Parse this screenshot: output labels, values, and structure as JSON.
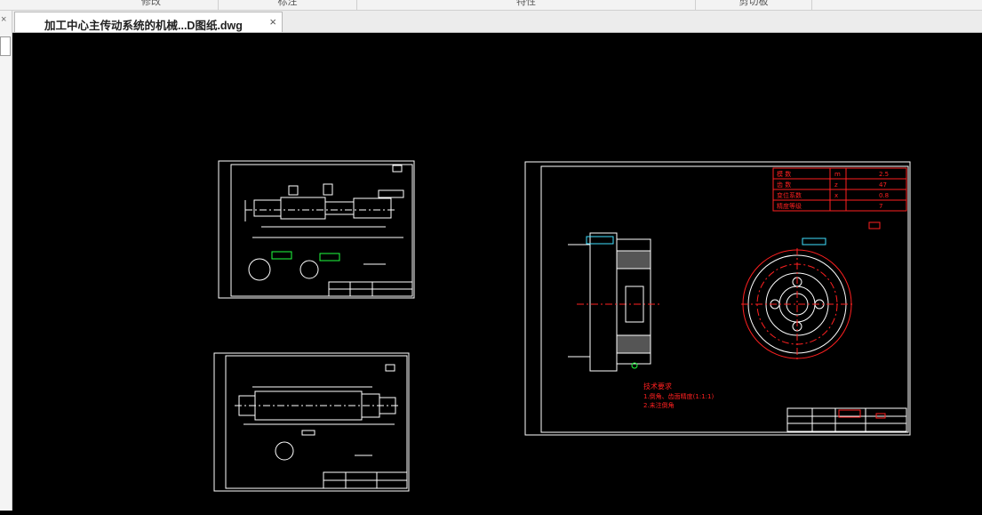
{
  "ribbon": {
    "groups": [
      {
        "label": "修改"
      },
      {
        "label": "标注"
      },
      {
        "label": "特性"
      },
      {
        "label": "剪切板"
      }
    ]
  },
  "document_tab": {
    "title": "加工中心主传动系统的机械...D图纸.dwg",
    "close_glyph": "×"
  },
  "left_panel": {
    "close_glyph": "×"
  },
  "drawing": {
    "background": "#000000",
    "colors": {
      "white": "#ffffff",
      "red": "#ff2020",
      "green": "#20ff40",
      "cyan": "#40e0ff"
    },
    "gear_table": {
      "rows": [
        {
          "name": "模 数",
          "symbol": "m",
          "value": "2.5"
        },
        {
          "name": "齿 数",
          "symbol": "z",
          "value": "47"
        },
        {
          "name": "变位系数",
          "symbol": "x",
          "value": "0.8"
        },
        {
          "name": "精度等级",
          "symbol": "",
          "value": "7"
        }
      ]
    },
    "tech_notes": {
      "heading": "技术要求",
      "lines": [
        "1.倒角、齿面精度(1:1:1)",
        "2.未注倒角"
      ]
    }
  }
}
